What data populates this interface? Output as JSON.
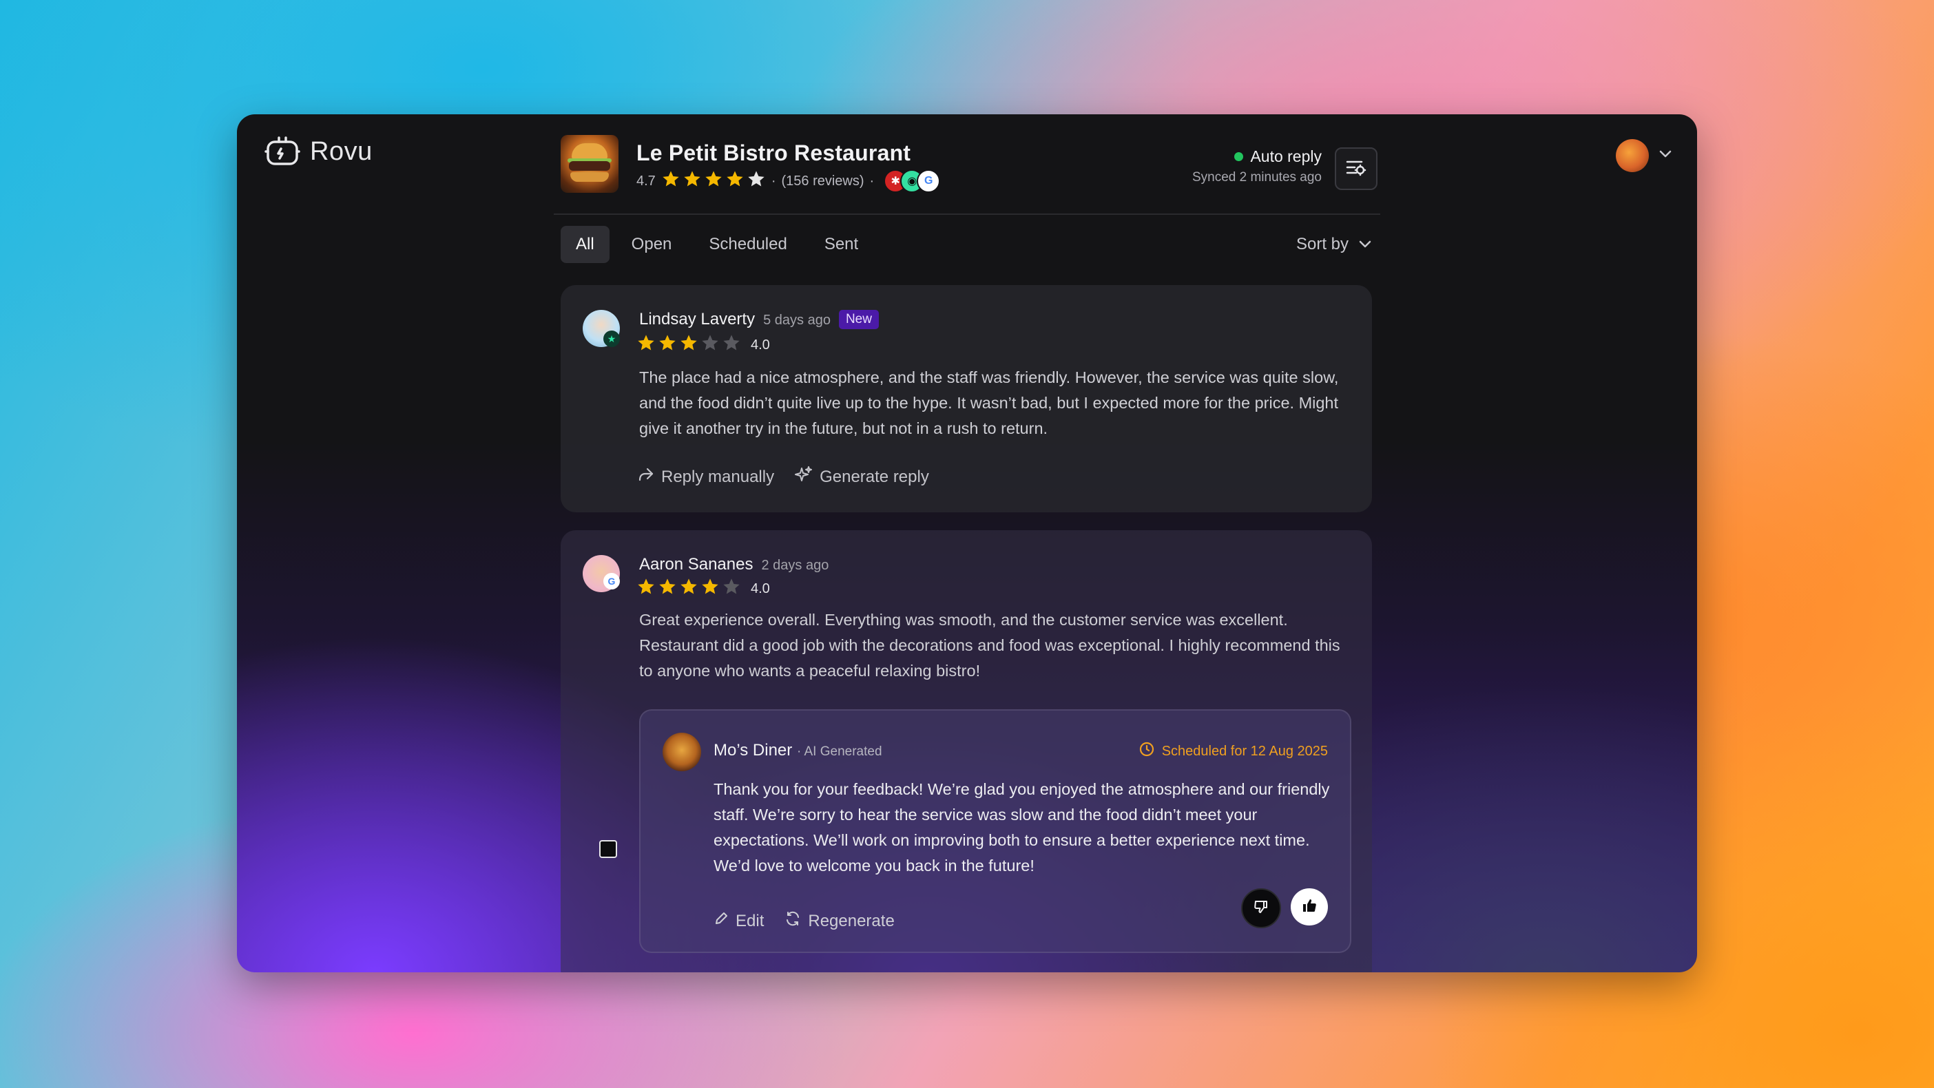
{
  "app": {
    "name": "Rovu"
  },
  "business": {
    "name": "Le Petit Bistro Restaurant",
    "rating": "4.7",
    "rating_value": 4.7,
    "reviews": "(156 reviews)",
    "separator": "·",
    "platforms": [
      {
        "name": "yelp",
        "glyph": "✱",
        "color": "#d32323"
      },
      {
        "name": "tripadvisor",
        "glyph": "◉",
        "color": "#34e0a1"
      },
      {
        "name": "google",
        "glyph": "G",
        "color": "#4285f4"
      }
    ]
  },
  "auto_reply": {
    "label": "Auto reply",
    "synced": "Synced 2 minutes ago",
    "status_color": "#22c55e"
  },
  "tabs": [
    {
      "label": "All",
      "active": true
    },
    {
      "label": "Open",
      "active": false
    },
    {
      "label": "Scheduled",
      "active": false
    },
    {
      "label": "Sent",
      "active": false
    }
  ],
  "sort": {
    "label": "Sort by"
  },
  "reviews": [
    {
      "author": "Lindsay Laverty",
      "time": "5 days ago",
      "badge": "New",
      "rating": "4.0",
      "stars_filled": 3,
      "platform": "trustpilot-star",
      "text": "The place had a nice atmosphere, and the staff was friendly. However, the service was quite slow, and the food didn’t quite live up to the hype. It wasn’t bad, but I expected more for the price. Might give it another try in the future, but not in a rush to return.",
      "actions": {
        "reply_manually": "Reply manually",
        "generate_reply": "Generate reply"
      }
    },
    {
      "author": "Aaron Sananes",
      "time": "2 days ago",
      "rating": "4.0",
      "stars_filled": 4,
      "platform": "google",
      "text": "Great experience overall. Everything was smooth, and the customer service was excellent. Restaurant did a good job with the decorations and food was exceptional. I highly recommend this to anyone who wants a peaceful relaxing bistro!",
      "reply": {
        "author": "Mo’s Diner",
        "tag": "· AI Generated",
        "scheduled": "Scheduled for 12 Aug 2025",
        "text": "Thank you for your feedback! We’re glad you enjoyed the atmosphere and our friendly staff. We’re sorry to hear the service was slow and the food didn’t meet your expectations. We’ll work on improving both to ensure a better experience next time. We’d love to welcome you back in the future!",
        "edit": "Edit",
        "regenerate": "Regenerate"
      }
    }
  ],
  "colors": {
    "star": "#f5b800",
    "star_empty": "#5a5a60",
    "accent_new": "#4b1aa8",
    "scheduled": "#f0a020"
  }
}
